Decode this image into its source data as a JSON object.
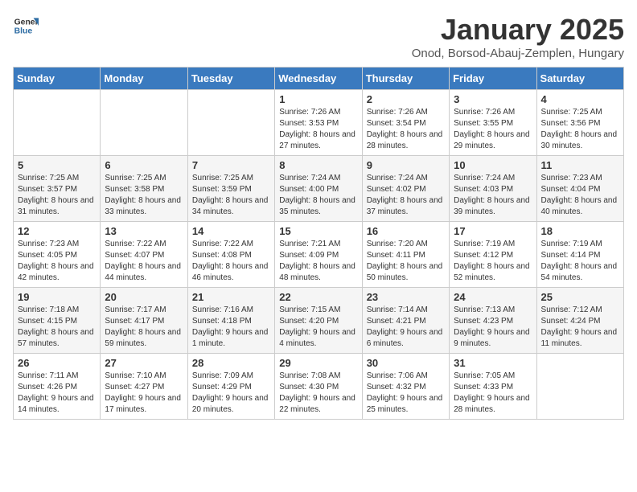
{
  "logo": {
    "text_general": "General",
    "text_blue": "Blue"
  },
  "title": "January 2025",
  "subtitle": "Onod, Borsod-Abauj-Zemplen, Hungary",
  "days_of_week": [
    "Sunday",
    "Monday",
    "Tuesday",
    "Wednesday",
    "Thursday",
    "Friday",
    "Saturday"
  ],
  "weeks": [
    [
      {
        "day": "",
        "info": ""
      },
      {
        "day": "",
        "info": ""
      },
      {
        "day": "",
        "info": ""
      },
      {
        "day": "1",
        "info": "Sunrise: 7:26 AM\nSunset: 3:53 PM\nDaylight: 8 hours and 27 minutes."
      },
      {
        "day": "2",
        "info": "Sunrise: 7:26 AM\nSunset: 3:54 PM\nDaylight: 8 hours and 28 minutes."
      },
      {
        "day": "3",
        "info": "Sunrise: 7:26 AM\nSunset: 3:55 PM\nDaylight: 8 hours and 29 minutes."
      },
      {
        "day": "4",
        "info": "Sunrise: 7:25 AM\nSunset: 3:56 PM\nDaylight: 8 hours and 30 minutes."
      }
    ],
    [
      {
        "day": "5",
        "info": "Sunrise: 7:25 AM\nSunset: 3:57 PM\nDaylight: 8 hours and 31 minutes."
      },
      {
        "day": "6",
        "info": "Sunrise: 7:25 AM\nSunset: 3:58 PM\nDaylight: 8 hours and 33 minutes."
      },
      {
        "day": "7",
        "info": "Sunrise: 7:25 AM\nSunset: 3:59 PM\nDaylight: 8 hours and 34 minutes."
      },
      {
        "day": "8",
        "info": "Sunrise: 7:24 AM\nSunset: 4:00 PM\nDaylight: 8 hours and 35 minutes."
      },
      {
        "day": "9",
        "info": "Sunrise: 7:24 AM\nSunset: 4:02 PM\nDaylight: 8 hours and 37 minutes."
      },
      {
        "day": "10",
        "info": "Sunrise: 7:24 AM\nSunset: 4:03 PM\nDaylight: 8 hours and 39 minutes."
      },
      {
        "day": "11",
        "info": "Sunrise: 7:23 AM\nSunset: 4:04 PM\nDaylight: 8 hours and 40 minutes."
      }
    ],
    [
      {
        "day": "12",
        "info": "Sunrise: 7:23 AM\nSunset: 4:05 PM\nDaylight: 8 hours and 42 minutes."
      },
      {
        "day": "13",
        "info": "Sunrise: 7:22 AM\nSunset: 4:07 PM\nDaylight: 8 hours and 44 minutes."
      },
      {
        "day": "14",
        "info": "Sunrise: 7:22 AM\nSunset: 4:08 PM\nDaylight: 8 hours and 46 minutes."
      },
      {
        "day": "15",
        "info": "Sunrise: 7:21 AM\nSunset: 4:09 PM\nDaylight: 8 hours and 48 minutes."
      },
      {
        "day": "16",
        "info": "Sunrise: 7:20 AM\nSunset: 4:11 PM\nDaylight: 8 hours and 50 minutes."
      },
      {
        "day": "17",
        "info": "Sunrise: 7:19 AM\nSunset: 4:12 PM\nDaylight: 8 hours and 52 minutes."
      },
      {
        "day": "18",
        "info": "Sunrise: 7:19 AM\nSunset: 4:14 PM\nDaylight: 8 hours and 54 minutes."
      }
    ],
    [
      {
        "day": "19",
        "info": "Sunrise: 7:18 AM\nSunset: 4:15 PM\nDaylight: 8 hours and 57 minutes."
      },
      {
        "day": "20",
        "info": "Sunrise: 7:17 AM\nSunset: 4:17 PM\nDaylight: 8 hours and 59 minutes."
      },
      {
        "day": "21",
        "info": "Sunrise: 7:16 AM\nSunset: 4:18 PM\nDaylight: 9 hours and 1 minute."
      },
      {
        "day": "22",
        "info": "Sunrise: 7:15 AM\nSunset: 4:20 PM\nDaylight: 9 hours and 4 minutes."
      },
      {
        "day": "23",
        "info": "Sunrise: 7:14 AM\nSunset: 4:21 PM\nDaylight: 9 hours and 6 minutes."
      },
      {
        "day": "24",
        "info": "Sunrise: 7:13 AM\nSunset: 4:23 PM\nDaylight: 9 hours and 9 minutes."
      },
      {
        "day": "25",
        "info": "Sunrise: 7:12 AM\nSunset: 4:24 PM\nDaylight: 9 hours and 11 minutes."
      }
    ],
    [
      {
        "day": "26",
        "info": "Sunrise: 7:11 AM\nSunset: 4:26 PM\nDaylight: 9 hours and 14 minutes."
      },
      {
        "day": "27",
        "info": "Sunrise: 7:10 AM\nSunset: 4:27 PM\nDaylight: 9 hours and 17 minutes."
      },
      {
        "day": "28",
        "info": "Sunrise: 7:09 AM\nSunset: 4:29 PM\nDaylight: 9 hours and 20 minutes."
      },
      {
        "day": "29",
        "info": "Sunrise: 7:08 AM\nSunset: 4:30 PM\nDaylight: 9 hours and 22 minutes."
      },
      {
        "day": "30",
        "info": "Sunrise: 7:06 AM\nSunset: 4:32 PM\nDaylight: 9 hours and 25 minutes."
      },
      {
        "day": "31",
        "info": "Sunrise: 7:05 AM\nSunset: 4:33 PM\nDaylight: 9 hours and 28 minutes."
      },
      {
        "day": "",
        "info": ""
      }
    ]
  ]
}
